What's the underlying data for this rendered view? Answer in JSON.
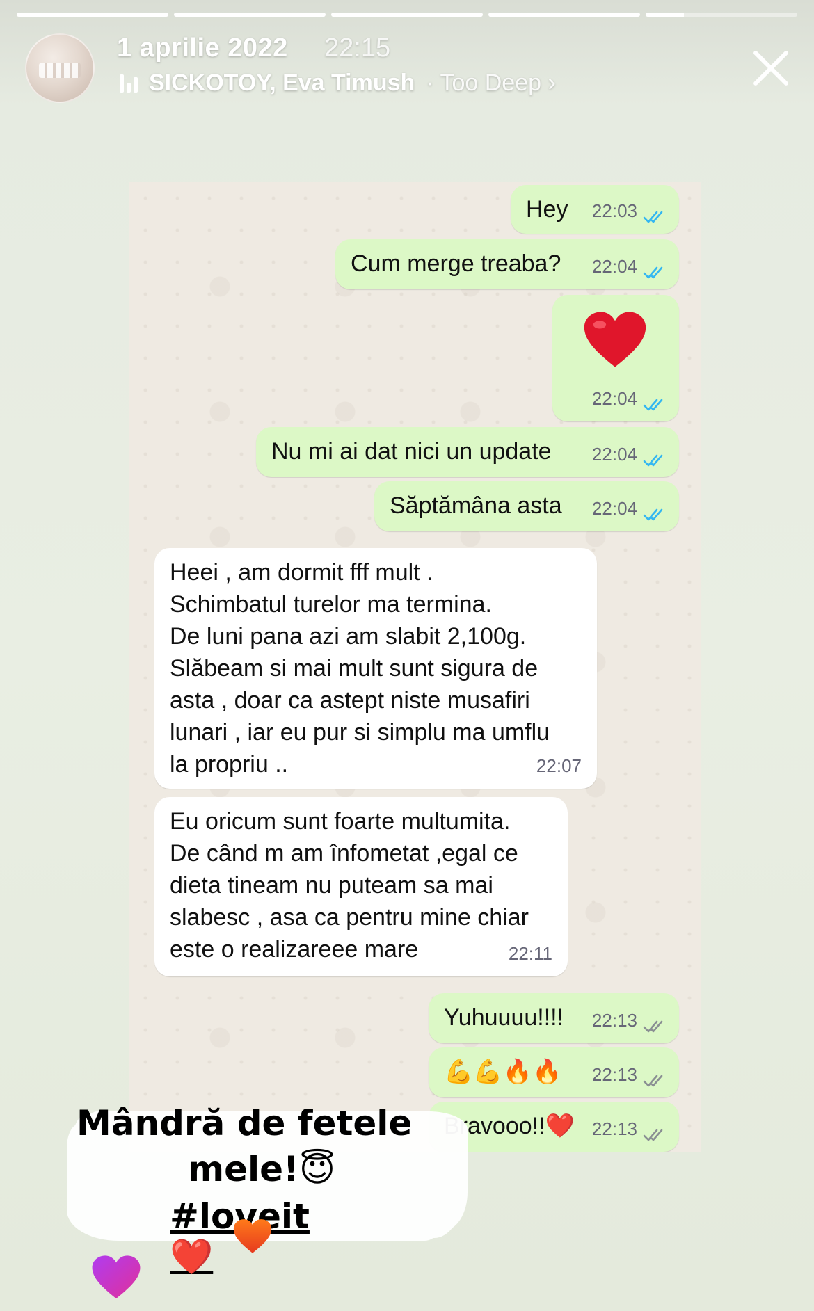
{
  "story": {
    "segments": [
      1,
      1,
      1,
      1,
      0.25
    ],
    "date": "1 aprilie 2022",
    "time": "22:15",
    "music_artists": "SICKOTOY, Eva Timush",
    "music_song": "· Too Deep ›"
  },
  "chat": {
    "messages": [
      {
        "text": "Hey",
        "time": "22:03"
      },
      {
        "text": "Cum merge treaba?",
        "time": "22:04"
      },
      {
        "text": "",
        "time": "22:04"
      },
      {
        "text": "Nu mi ai dat nici un update",
        "time": "22:04"
      },
      {
        "text": "Săptămâna asta",
        "time": "22:04"
      },
      {
        "text": "Heei , am dormit fff mult .\nSchimbatul turelor ma termina.\nDe luni pana azi am slabit 2,100g.\nSlăbeam si mai mult sunt sigura de\nasta , doar ca astept niste musafiri\nlunari , iar eu pur si simplu ma umflu\nla propriu ..",
        "time": "22:07"
      },
      {
        "text": "Eu oricum sunt foarte multumita.\nDe când m am înfometat  ,egal ce\ndieta tineam nu puteam sa mai\nslabesc , asa ca pentru mine chiar\neste o realizareee mare",
        "time": "22:11"
      },
      {
        "text": "Yuhuuuu!!!!",
        "time": "22:13"
      },
      {
        "text": "💪💪🔥🔥",
        "time": "22:13"
      },
      {
        "text": "Bravooo!!❤️",
        "time": "22:13"
      }
    ],
    "colors": {
      "outgoing": "#dcf8c6",
      "incoming": "#ffffff",
      "read_tick": "#34b7f1",
      "sent_tick": "#8a8f93"
    }
  },
  "sticker": {
    "line1": "Mândră de fetele",
    "line2": "mele!😇",
    "line3": "#loveit❤️"
  }
}
